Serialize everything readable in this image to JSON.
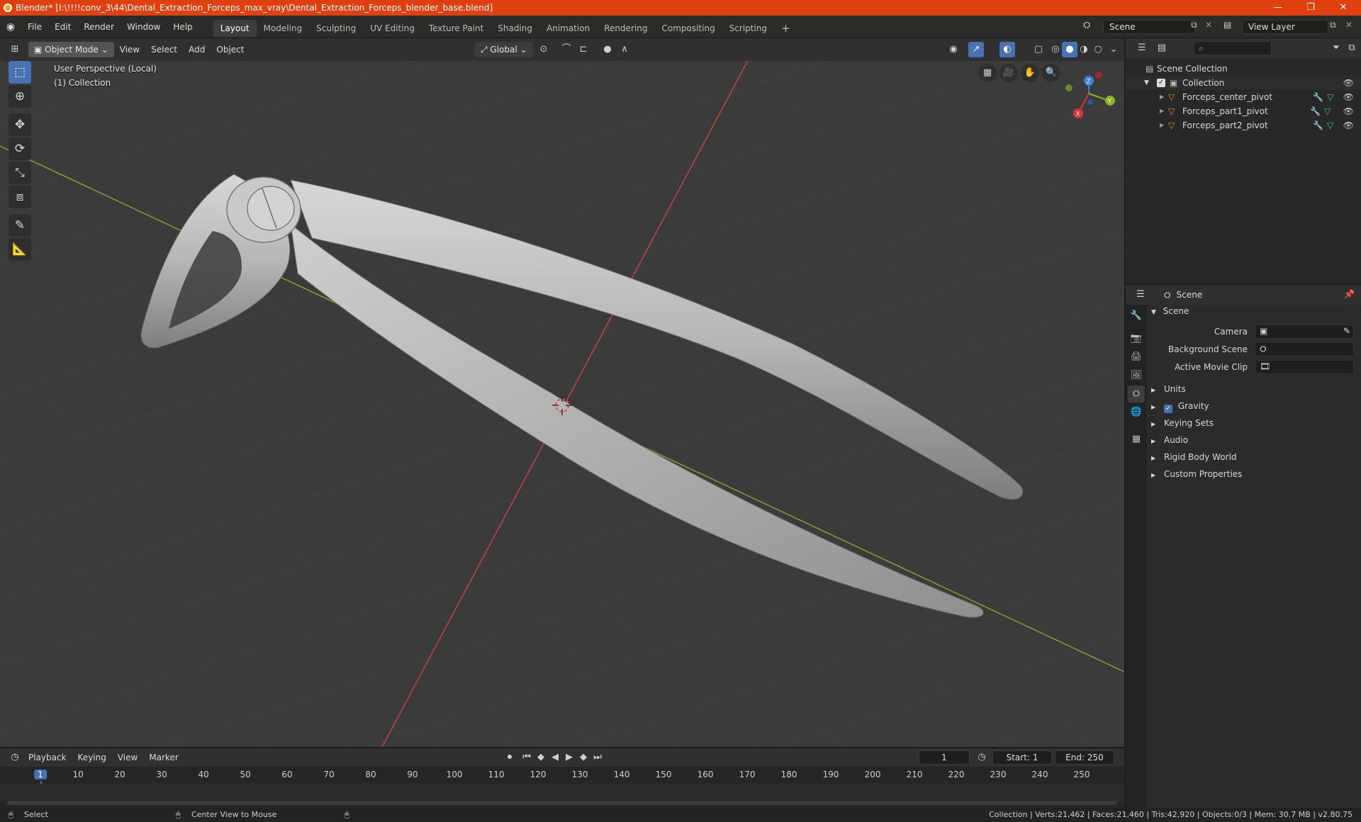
{
  "window": {
    "title": "Blender* [I:\\!!!!conv_3\\44\\Dental_Extraction_Forceps_max_vray\\Dental_Extraction_Forceps_blender_base.blend]",
    "minimize": "—",
    "maximize": "❐",
    "close": "✕"
  },
  "menubar": {
    "items": [
      "File",
      "Edit",
      "Render",
      "Window",
      "Help"
    ]
  },
  "workspaces": [
    "Layout",
    "Modeling",
    "Sculpting",
    "UV Editing",
    "Texture Paint",
    "Shading",
    "Animation",
    "Rendering",
    "Compositing",
    "Scripting"
  ],
  "scene_field": "Scene",
  "view_layer_field": "View Layer",
  "viewport_header": {
    "mode": "Object Mode",
    "menus": [
      "View",
      "Select",
      "Add",
      "Object"
    ],
    "transform": "Global"
  },
  "viewport": {
    "perspective_label": "User Perspective (Local)",
    "collection_label": "(1) Collection",
    "gizmo": {
      "x": "X",
      "y": "Y",
      "z": "Z"
    }
  },
  "outliner": {
    "root": "Scene Collection",
    "collection": "Collection",
    "objects": [
      "Forceps_center_pivot",
      "Forceps_part1_pivot",
      "Forceps_part2_pivot"
    ]
  },
  "properties": {
    "header": "Scene",
    "panel_title": "Scene",
    "camera_label": "Camera",
    "background_scene_label": "Background Scene",
    "movie_clip_label": "Active Movie Clip",
    "subpanels": [
      "Units",
      "Gravity",
      "Keying Sets",
      "Audio",
      "Rigid Body World",
      "Custom Properties"
    ]
  },
  "timeline": {
    "menus": [
      "Playback",
      "Keying",
      "View",
      "Marker"
    ],
    "current_frame": "1",
    "start_label": "Start:",
    "start": "1",
    "end_label": "End:",
    "end": "250",
    "ticks": [
      "1",
      "10",
      "20",
      "30",
      "40",
      "50",
      "60",
      "70",
      "80",
      "90",
      "100",
      "110",
      "120",
      "130",
      "140",
      "150",
      "160",
      "170",
      "180",
      "190",
      "200",
      "210",
      "220",
      "230",
      "240",
      "250"
    ]
  },
  "statusbar": {
    "select": "Select",
    "center": "Center View to Mouse",
    "stats": "Collection | Verts:21,462 | Faces:21,460 | Tris:42,920 | Objects:0/3 | Mem: 30.7 MB | v2.80.75"
  },
  "colors": {
    "titlebar": "#e04010",
    "accent": "#4772b3",
    "x_axis": "#d9343d",
    "y_axis": "#8ab51f",
    "z_axis": "#3a80e0"
  }
}
